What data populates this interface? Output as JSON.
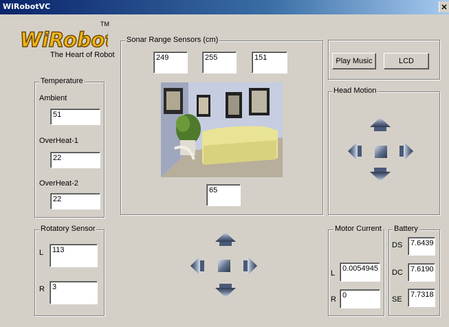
{
  "window": {
    "title": "WiRobotVC",
    "close_glyph": "×"
  },
  "logo": {
    "text": "WiRobot",
    "tm": "TM",
    "tagline": "The Heart of Robot"
  },
  "temperature": {
    "legend": "Temperature",
    "ambient_label": "Ambient",
    "ambient_value": "51",
    "overheat1_label": "OverHeat-1",
    "overheat1_value": "22",
    "overheat2_label": "OverHeat-2",
    "overheat2_value": "22"
  },
  "sonar": {
    "legend": "Sonar Range Sensors (cm)",
    "left": "249",
    "center": "255",
    "right": "151",
    "bottom": "65"
  },
  "buttons": {
    "play_music": "Play Music",
    "lcd": "LCD"
  },
  "head_motion": {
    "legend": "Head Motion"
  },
  "rotatory": {
    "legend": "Rotatory Sensor",
    "l_label": "L",
    "l_value": "113",
    "r_label": "R",
    "r_value": "3"
  },
  "motor_current": {
    "legend": "Motor Current",
    "l_label": "L",
    "l_value": "0.0054945",
    "r_label": "R",
    "r_value": "0"
  },
  "battery": {
    "legend": "Battery",
    "ds_label": "DS",
    "ds_value": "7.6439",
    "dc_label": "DC",
    "dc_value": "7.6190",
    "se_label": "SE",
    "se_value": "7.7318"
  },
  "icons": [
    "up-arrow-icon",
    "down-arrow-icon",
    "left-arrow-icon",
    "right-arrow-icon",
    "stop-icon"
  ],
  "colors": {
    "arrow_dark": "#4a5a78",
    "arrow_light": "#c8d0dc",
    "titlebar": "#0a246a",
    "logo_fill": "#f2b418"
  }
}
